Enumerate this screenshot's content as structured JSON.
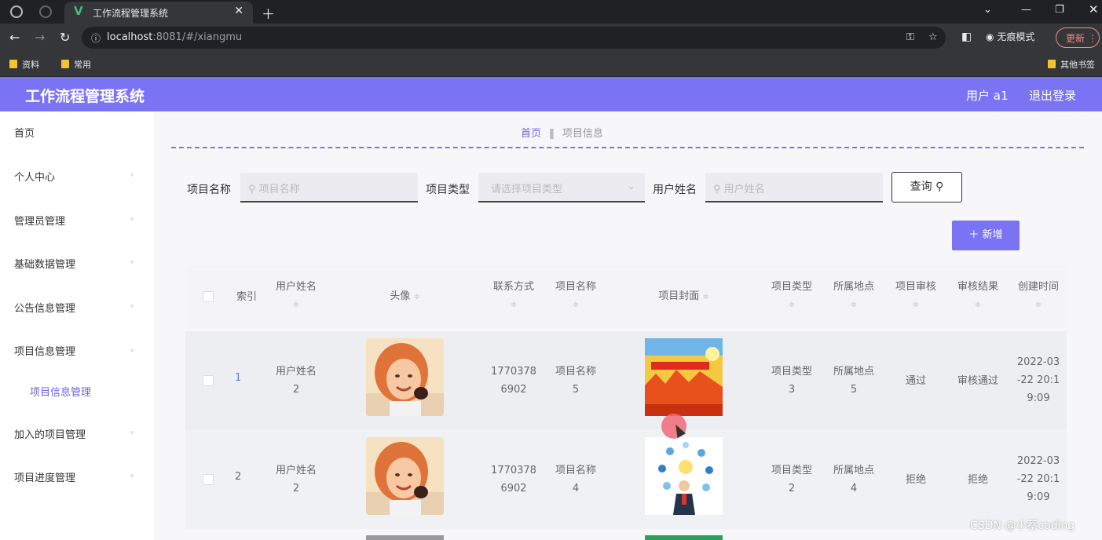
{
  "browser": {
    "tab_title": "工作流程管理系统",
    "url_host": "localhost",
    "url_rest": ":8081/#/xiangmu",
    "incognito_label": "无痕模式",
    "update_label": "更新",
    "bookmarks": [
      "资料",
      "常用"
    ],
    "other_bookmarks": "其他书签"
  },
  "header": {
    "title": "工作流程管理系统",
    "user": "用户 a1",
    "logout": "退出登录"
  },
  "sidebar": {
    "items": [
      {
        "label": "首页"
      },
      {
        "label": "个人中心"
      },
      {
        "label": "管理员管理"
      },
      {
        "label": "基础数据管理"
      },
      {
        "label": "公告信息管理"
      },
      {
        "label": "项目信息管理"
      },
      {
        "label": "项目信息管理",
        "sub": true
      },
      {
        "label": "加入的项目管理"
      },
      {
        "label": "项目进度管理"
      }
    ]
  },
  "breadcrumb": {
    "home": "首页",
    "current": "项目信息"
  },
  "search": {
    "name_label": "项目名称",
    "name_placeholder": "项目名称",
    "type_label": "项目类型",
    "type_placeholder": "请选择项目类型",
    "user_label": "用户姓名",
    "user_placeholder": "用户姓名",
    "query_label": "查询"
  },
  "add_label": "＋ 新增",
  "table": {
    "columns": {
      "index": "索引",
      "user": "用户姓名",
      "avatar": "头像",
      "contact": "联系方式",
      "name": "项目名称",
      "cover": "项目封面",
      "type": "项目类型",
      "place": "所属地点",
      "audit": "项目审核",
      "result": "审核结果",
      "created": "创建时间"
    },
    "rows": [
      {
        "index": "1",
        "user": [
          "用户姓名",
          "2"
        ],
        "contact": [
          "1770378",
          "6902"
        ],
        "name": [
          "项目名称",
          "5"
        ],
        "type": [
          "项目类型",
          "3"
        ],
        "place": [
          "所属地点",
          "5"
        ],
        "audit": "通过",
        "result": "审核通过",
        "created": [
          "2022-03",
          "-22 20:1",
          "9:09"
        ]
      },
      {
        "index": "2",
        "user": [
          "用户姓名",
          "2"
        ],
        "contact": [
          "1770378",
          "6902"
        ],
        "name": [
          "项目名称",
          "4"
        ],
        "type": [
          "项目类型",
          "2"
        ],
        "place": [
          "所属地点",
          "4"
        ],
        "audit": "拒绝",
        "result": "拒绝",
        "created": [
          "2022-03",
          "-22 20:1",
          "9:09"
        ]
      }
    ]
  },
  "watermark": "CSDN @小蔡coding"
}
